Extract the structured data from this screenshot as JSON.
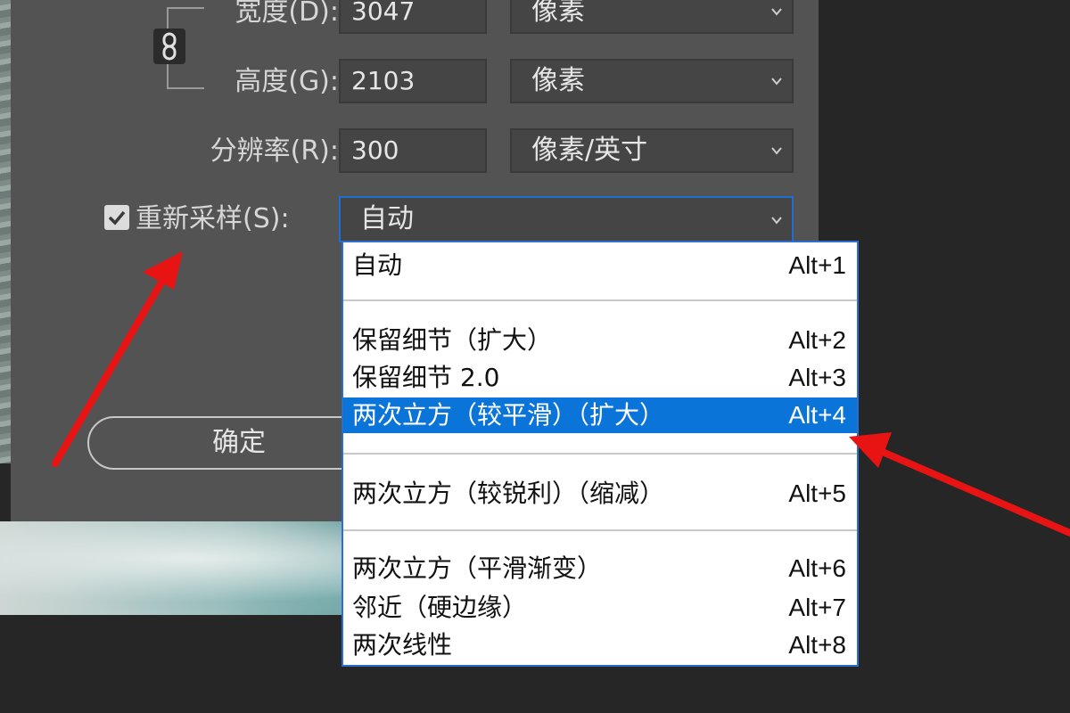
{
  "dialog": {
    "width_label": "宽度(D):",
    "width_value": "3047",
    "width_unit": "像素",
    "height_label": "高度(G):",
    "height_value": "2103",
    "height_unit": "像素",
    "resolution_label": "分辨率(R):",
    "resolution_value": "300",
    "resolution_unit": "像素/英寸",
    "resample_label": "重新采样(S):",
    "resample_checked": true,
    "resample_value": "自动",
    "ok_label": "确定"
  },
  "menu": {
    "items": [
      {
        "label": "自动",
        "shortcut": "Alt+1"
      },
      {
        "label": "保留细节（扩大）",
        "shortcut": "Alt+2"
      },
      {
        "label": "保留细节 2.0",
        "shortcut": "Alt+3"
      },
      {
        "label": "两次立方（较平滑）（扩大）",
        "shortcut": "Alt+4",
        "highlighted": true
      },
      {
        "label": "两次立方（较锐利）（缩减）",
        "shortcut": "Alt+5"
      },
      {
        "label": "两次立方（平滑渐变）",
        "shortcut": "Alt+6"
      },
      {
        "label": "邻近（硬边缘）",
        "shortcut": "Alt+7"
      },
      {
        "label": "两次线性",
        "shortcut": "Alt+8"
      }
    ]
  },
  "colors": {
    "dialog_bg": "#535353",
    "page_bg": "#262626",
    "highlight": "#0b74d9",
    "arrow": "#e81414"
  },
  "icons": [
    "chain-link-icon",
    "checkmark-icon",
    "chevron-down-icon",
    "annotation-arrow"
  ]
}
